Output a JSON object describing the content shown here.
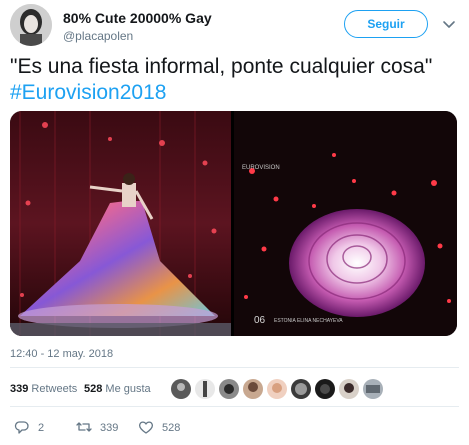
{
  "tweet": {
    "display_name": "80% Cute 20000% Gay",
    "handle": "@placapolen",
    "follow_label": "Seguir",
    "text": "\"Es una fiesta informal, ponte cualquier cosa\"",
    "hashtag": "#Eurovision2018",
    "timestamp": "12:40 - 12 may. 2018"
  },
  "stats": {
    "retweets_count": "339",
    "retweets_label": "Retweets",
    "likes_count": "528",
    "likes_label": "Me gusta"
  },
  "media": {
    "photo_2_overlay_top": "EUROVISION",
    "photo_2_overlay_bottom_num": "06",
    "photo_2_overlay_bottom_text": "ESTONIA ELINA NECHAYEVA"
  },
  "actions": {
    "reply_count": "2",
    "retweet_count": "339",
    "like_count": "528"
  },
  "colors": {
    "accent": "#1da1f2",
    "text": "#14171a",
    "secondary": "#657786",
    "divider": "#e6ecf0"
  },
  "icons": [
    "chevron-down-icon",
    "reply-icon",
    "retweet-icon",
    "like-icon"
  ]
}
